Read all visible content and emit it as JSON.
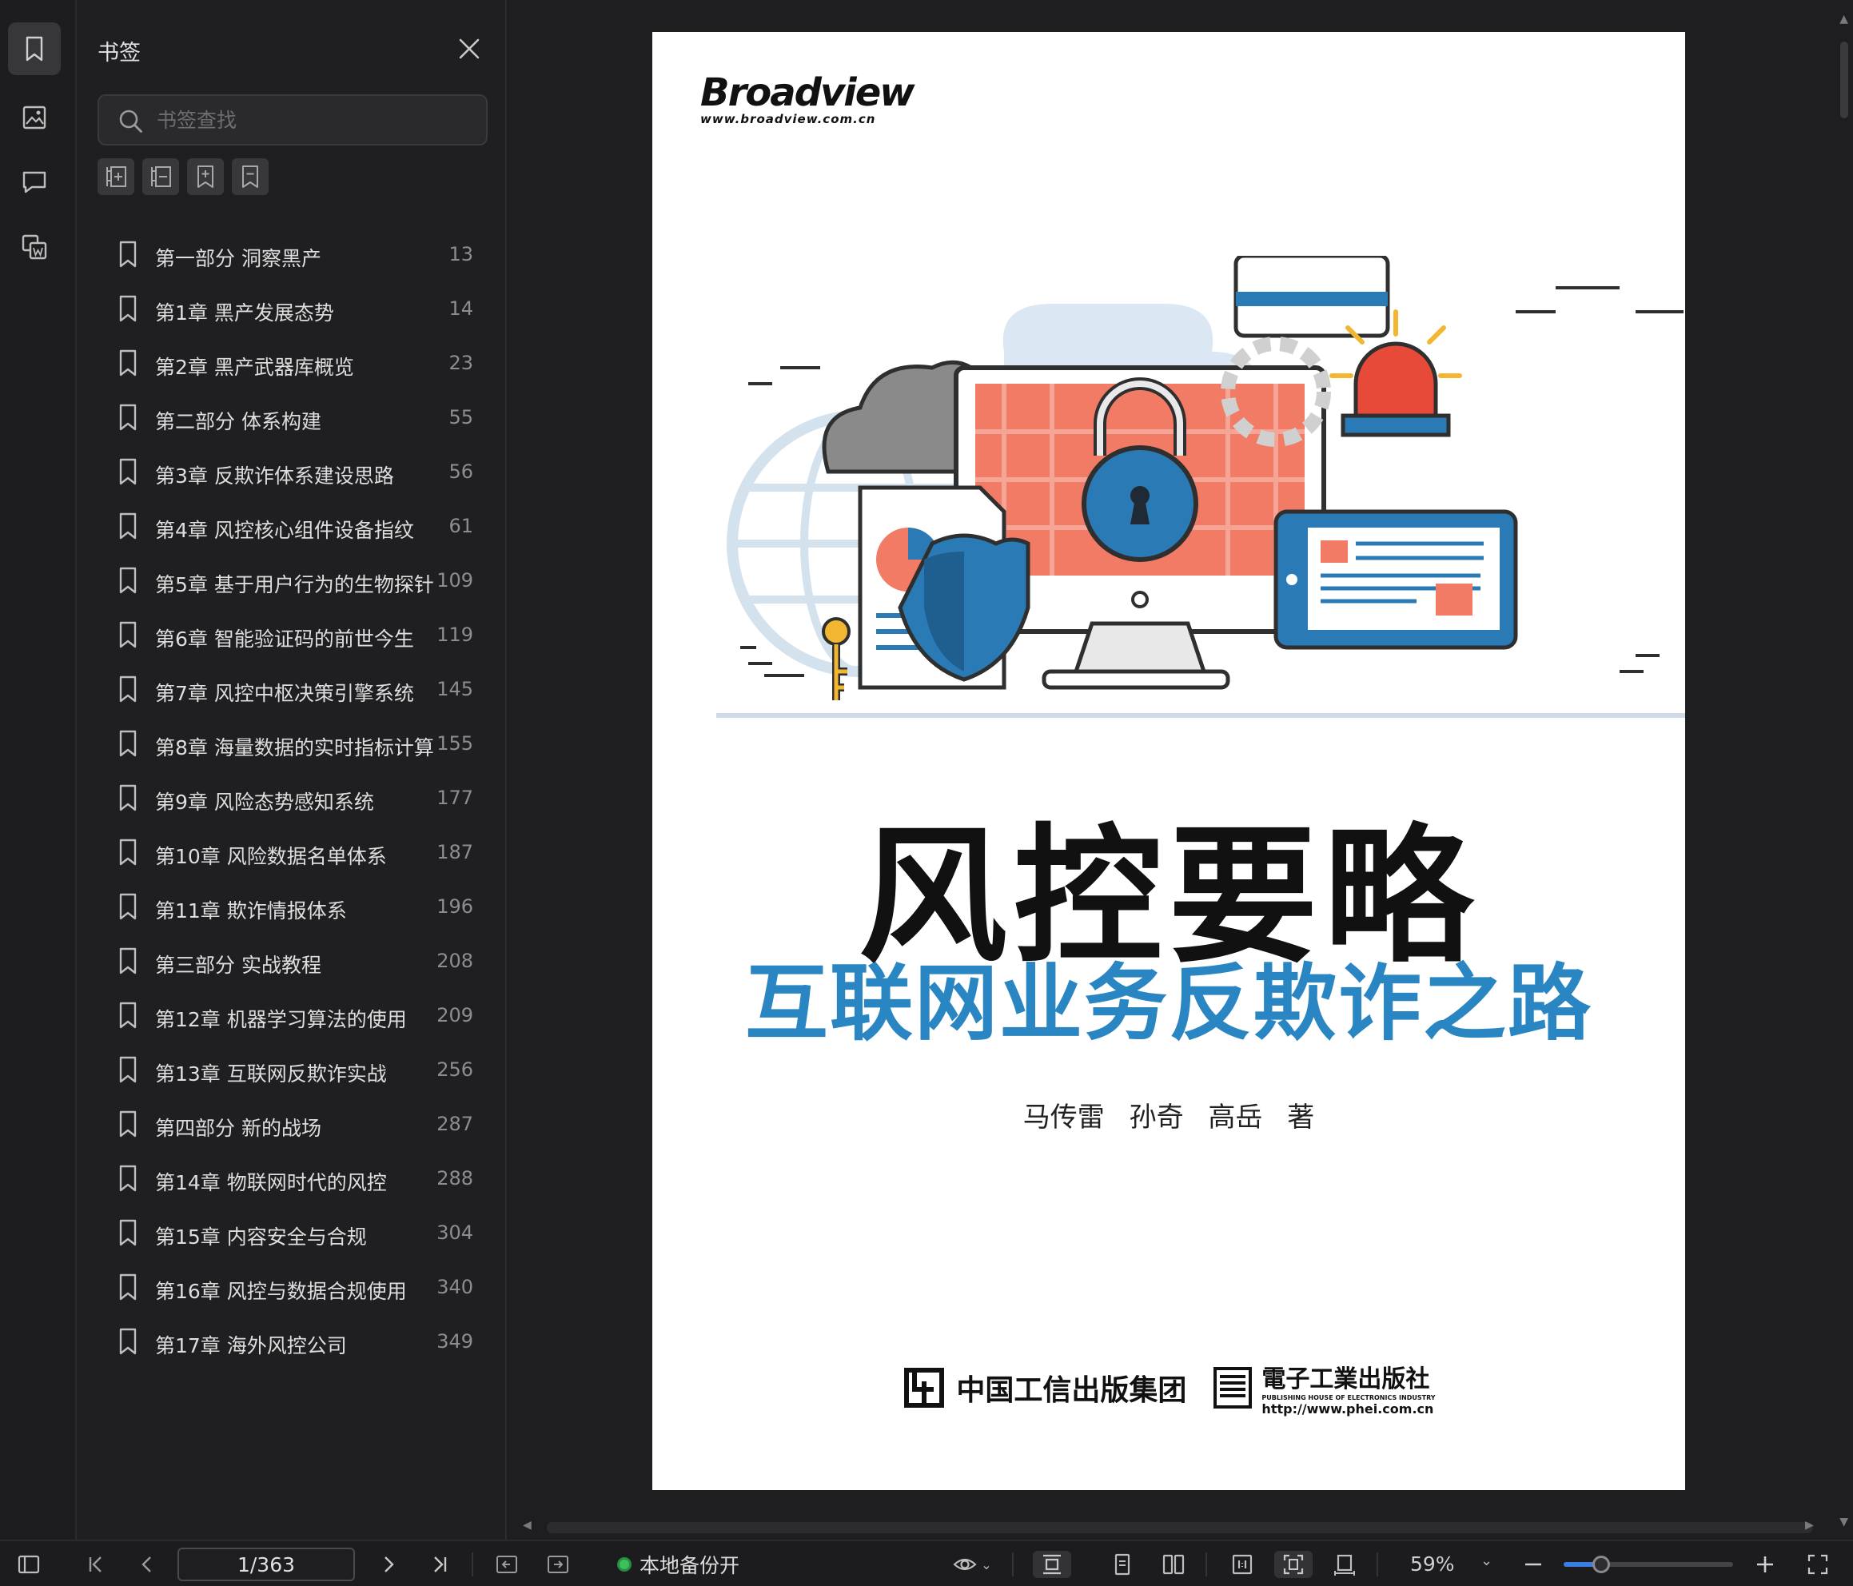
{
  "panel": {
    "title": "书签",
    "search_placeholder": "书签查找"
  },
  "bookmarks": [
    {
      "label": "第一部分 洞察黑产",
      "page": "13"
    },
    {
      "label": "第1章 黑产发展态势",
      "page": "14"
    },
    {
      "label": "第2章 黑产武器库概览",
      "page": "23"
    },
    {
      "label": "第二部分 体系构建",
      "page": "55"
    },
    {
      "label": "第3章 反欺诈体系建设思路",
      "page": "56"
    },
    {
      "label": "第4章 风控核心组件设备指纹",
      "page": "61"
    },
    {
      "label": "第5章 基于用户行为的生物探针",
      "page": "109"
    },
    {
      "label": "第6章 智能验证码的前世今生",
      "page": "119"
    },
    {
      "label": "第7章 风控中枢决策引擎系统",
      "page": "145"
    },
    {
      "label": "第8章 海量数据的实时指标计算",
      "page": "155"
    },
    {
      "label": "第9章 风险态势感知系统",
      "page": "177"
    },
    {
      "label": "第10章 风险数据名单体系",
      "page": "187"
    },
    {
      "label": "第11章 欺诈情报体系",
      "page": "196"
    },
    {
      "label": "第三部分 实战教程",
      "page": "208"
    },
    {
      "label": "第12章 机器学习算法的使用",
      "page": "209"
    },
    {
      "label": "第13章 互联网反欺诈实战",
      "page": "256"
    },
    {
      "label": "第四部分 新的战场",
      "page": "287"
    },
    {
      "label": "第14章 物联网时代的风控",
      "page": "288"
    },
    {
      "label": "第15章 内容安全与合规",
      "page": "304"
    },
    {
      "label": "第16章 风控与数据合规使用",
      "page": "340"
    },
    {
      "label": "第17章 海外风控公司",
      "page": "349"
    }
  ],
  "book": {
    "publisher_brand": "Broadview",
    "publisher_url": "www.broadview.com.cn",
    "title": "风控要略",
    "subtitle": "互联网业务反欺诈之路",
    "authors": "马传雷  孙奇  高岳  著",
    "group_name": "中国工信出版集团",
    "press_name": "電子工業出版社",
    "press_en": "PUBLISHING HOUSE OF ELECTRONICS INDUSTRY",
    "press_url": "http://www.phei.com.cn"
  },
  "toolbar": {
    "page_indicator": "1/363",
    "backup_status": "本地备份开",
    "zoom": "59%",
    "zoom_level": 0.22
  },
  "colors": {
    "accent": "#3a7fe0",
    "subtitle_blue": "#2a86c2",
    "status_green": "#3dbf5a"
  }
}
